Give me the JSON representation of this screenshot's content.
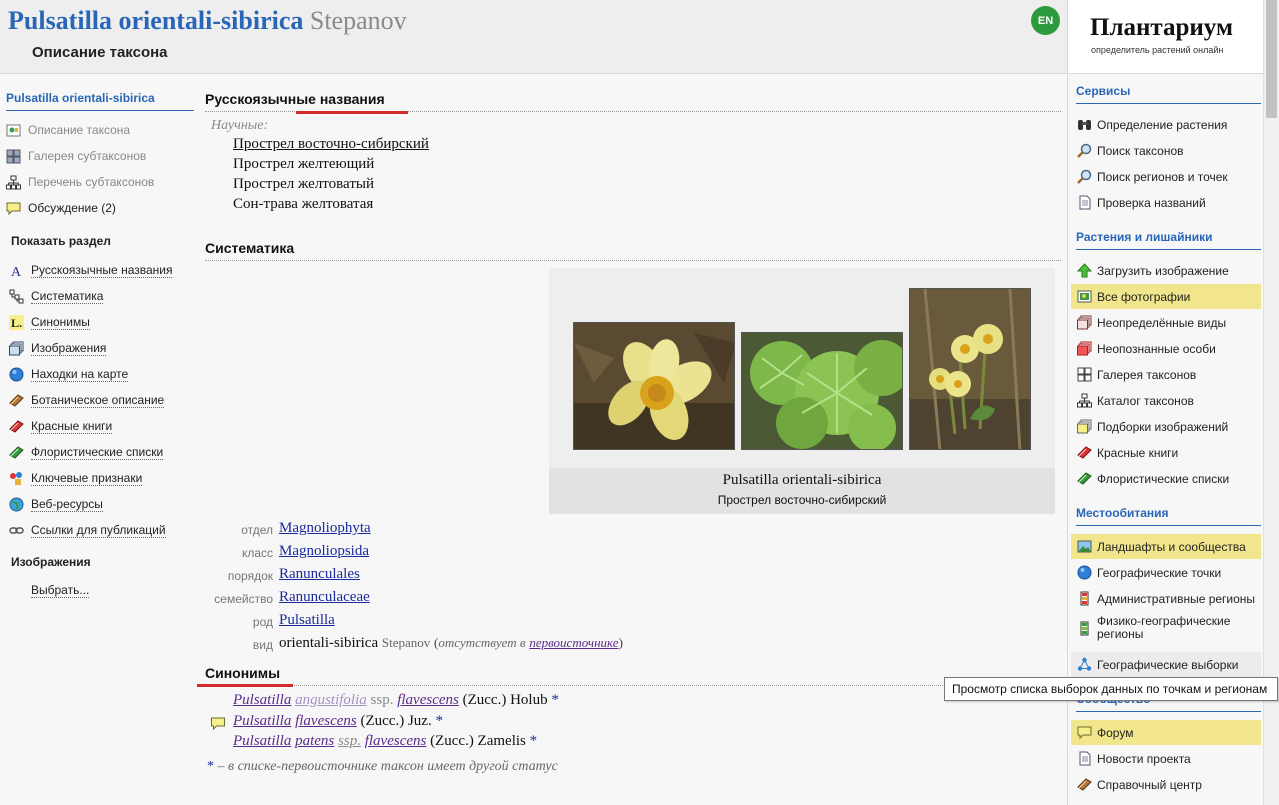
{
  "header": {
    "title_name": "Pulsatilla orientali-sibirica",
    "title_author": "Stepanov",
    "subtitle": "Описание таксона",
    "lang_button": "EN"
  },
  "brand": {
    "title": "Плантариум",
    "subtitle": "определитель растений онлайн"
  },
  "left_sidebar": {
    "taxon_title": "Pulsatilla orientali-sibirica",
    "items": [
      {
        "label": "Описание таксона",
        "icon": "taxon-description-icon"
      },
      {
        "label": "Галерея субтаксонов",
        "icon": "gallery-icon"
      },
      {
        "label": "Перечень субтаксонов",
        "icon": "tree-icon"
      },
      {
        "label": "Обсуждение (2)",
        "icon": "speech-bubble-icon"
      }
    ],
    "show_section_heading": "Показать раздел",
    "sections": [
      {
        "label": "Русскоязычные названия",
        "icon": "letter-a-icon"
      },
      {
        "label": "Систематика",
        "icon": "hierarchy-icon"
      },
      {
        "label": "Синонимы",
        "icon": "letter-l-icon"
      },
      {
        "label": "Изображения",
        "icon": "images-icon"
      },
      {
        "label": "Находки на карте",
        "icon": "globe-icon"
      },
      {
        "label": "Ботаническое описание",
        "icon": "book-icon"
      },
      {
        "label": "Красные книги",
        "icon": "red-book-icon"
      },
      {
        "label": "Флористические списки",
        "icon": "green-book-icon"
      },
      {
        "label": "Ключевые признаки",
        "icon": "key-features-icon"
      },
      {
        "label": "Веб-ресурсы",
        "icon": "web-globe-icon"
      },
      {
        "label": "Ссылки для публикаций",
        "icon": "chain-link-icon"
      }
    ],
    "images_heading": "Изображения",
    "images_choose": "Выбрать..."
  },
  "right_sidebar": {
    "sections": [
      {
        "title": "Сервисы",
        "items": [
          {
            "label": "Определение растения",
            "icon": "binoculars-icon"
          },
          {
            "label": "Поиск таксонов",
            "icon": "magnifier-icon"
          },
          {
            "label": "Поиск регионов и точек",
            "icon": "magnifier-icon"
          },
          {
            "label": "Проверка названий",
            "icon": "document-icon"
          }
        ]
      },
      {
        "title": "Растения и лишайники",
        "items": [
          {
            "label": "Загрузить изображение",
            "icon": "upload-arrow-icon"
          },
          {
            "label": "Все фотографии",
            "icon": "photo-icon"
          },
          {
            "label": "Неопределённые виды",
            "icon": "stack-icon"
          },
          {
            "label": "Неопознанные особи",
            "icon": "stack-red-icon"
          },
          {
            "label": "Галерея таксонов",
            "icon": "gallery-icon"
          },
          {
            "label": "Каталог таксонов",
            "icon": "tree-icon"
          },
          {
            "label": "Подборки изображений",
            "icon": "collection-icon"
          },
          {
            "label": "Красные книги",
            "icon": "red-book-icon"
          },
          {
            "label": "Флористические списки",
            "icon": "green-book-icon"
          }
        ]
      },
      {
        "title": "Местообитания",
        "items": [
          {
            "label": "Ландшафты и сообщества",
            "icon": "landscape-icon"
          },
          {
            "label": "Географические точки",
            "icon": "globe-icon"
          },
          {
            "label": "Административные регионы",
            "icon": "admin-regions-icon"
          },
          {
            "label": "Физико-географические регионы",
            "icon": "physio-regions-icon"
          },
          {
            "label": "Географические выборки",
            "icon": "network-icon"
          }
        ]
      },
      {
        "title": "Сообщество",
        "items": [
          {
            "label": "Форум",
            "icon": "speech-bubble-icon"
          },
          {
            "label": "Новости проекта",
            "icon": "document-icon"
          },
          {
            "label": "Справочный центр",
            "icon": "book-icon"
          }
        ]
      }
    ],
    "tooltip": "Просмотр списка выборок данных по точкам и регионам"
  },
  "main": {
    "russian_names": {
      "heading": "Русскоязычные названия",
      "scientific_label": "Научные:",
      "names": [
        "Прострел восточно-сибирский",
        "Прострел желтеющий",
        "Прострел желтоватый",
        "Сон-трава желтоватая"
      ]
    },
    "systematics": {
      "heading": "Систематика",
      "photo_caption_latin": "Pulsatilla orientali-sibirica",
      "photo_caption_ru": "Прострел восточно-сибирский",
      "ranks": [
        {
          "rank": "отдел",
          "value": "Magnoliophyta"
        },
        {
          "rank": "класс",
          "value": "Magnoliopsida"
        },
        {
          "rank": "порядок",
          "value": "Ranunculales"
        },
        {
          "rank": "семейство",
          "value": "Ranunculaceae"
        },
        {
          "rank": "род",
          "value": "Pulsatilla"
        }
      ],
      "species_rank": "вид",
      "species_name": "orientali-sibirica",
      "species_author": "Stepanov",
      "species_note_prefix": "(",
      "species_note_italic": "отсутствует в",
      "species_note_link": "первоисточнике",
      "species_note_suffix": ")"
    },
    "synonyms": {
      "heading": "Синонимы",
      "items": [
        {
          "genus": "Pulsatilla",
          "species": "angustifolia",
          "rank": "ssp.",
          "infra": "flavescens",
          "author": "(Zucc.) Holub",
          "star": "*"
        },
        {
          "genus": "Pulsatilla",
          "species": "flavescens",
          "rank": "",
          "infra": "",
          "author": "(Zucc.) Juz.",
          "star": "*"
        },
        {
          "genus": "Pulsatilla",
          "species": "patens",
          "rank": "ssp.",
          "infra": "flavescens",
          "author": "(Zucc.) Zamelis",
          "star": "*"
        }
      ],
      "note_star": "*",
      "note_text": " – в списке-первоисточнике таксон имеет другой статус"
    }
  },
  "colors": {
    "link_blue": "#2a66b8",
    "highlight_yellow": "#f2e68c",
    "accent_red": "#d62b2b",
    "lang_green": "#2c9b3e"
  }
}
